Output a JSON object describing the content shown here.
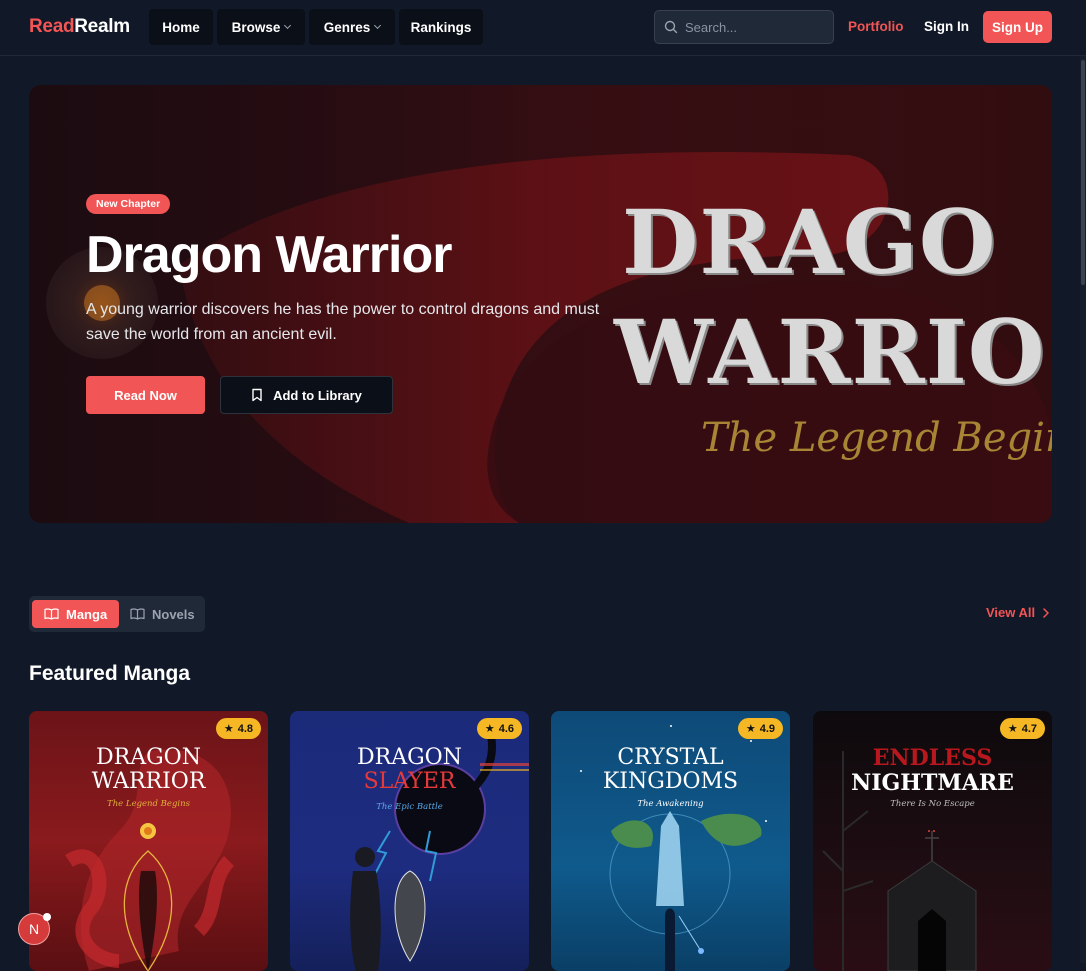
{
  "nav": {
    "logo_part1": "Read",
    "logo_part2": "Realm",
    "items": [
      {
        "label": "Home",
        "dropdown": false
      },
      {
        "label": "Browse",
        "dropdown": true
      },
      {
        "label": "Genres",
        "dropdown": true
      },
      {
        "label": "Rankings",
        "dropdown": false
      }
    ],
    "search_placeholder": "Search...",
    "portfolio_label": "Portfolio",
    "signin_label": "Sign In",
    "signup_label": "Sign Up"
  },
  "hero": {
    "badge": "New Chapter",
    "title": "Dragon Warrior",
    "description": "A young warrior discovers he has the power to control dragons and must save the world from an ancient evil.",
    "read_button": "Read Now",
    "library_button": "Add to Library",
    "art_title_line1": "DRAGO",
    "art_title_line2": "WARRIO",
    "art_subtitle": "The Legend Begins"
  },
  "tabs": [
    {
      "label": "Manga",
      "active": true,
      "icon": "book-open-icon"
    },
    {
      "label": "Novels",
      "active": false,
      "icon": "book-open-icon"
    }
  ],
  "view_all": "View All",
  "section_title": "Featured Manga",
  "cards": [
    {
      "title_line1": "DRAGON",
      "title_line2": "WARRIOR",
      "subtitle": "The Legend Begins",
      "rating": "4.8"
    },
    {
      "title_line1": "DRAGON",
      "title_line2": "SLAYER",
      "subtitle": "The Epic Battle",
      "rating": "4.6"
    },
    {
      "title_line1": "CRYSTAL",
      "title_line2": "KINGDOMS",
      "subtitle": "The Awakening",
      "rating": "4.9"
    },
    {
      "title_line1": "ENDLESS",
      "title_line2": "NIGHTMARE",
      "subtitle": "There Is No Escape",
      "rating": "4.7"
    }
  ],
  "dev_badge": "N",
  "colors": {
    "accent": "#f25555",
    "background": "#111827",
    "rating": "#f5b824"
  }
}
